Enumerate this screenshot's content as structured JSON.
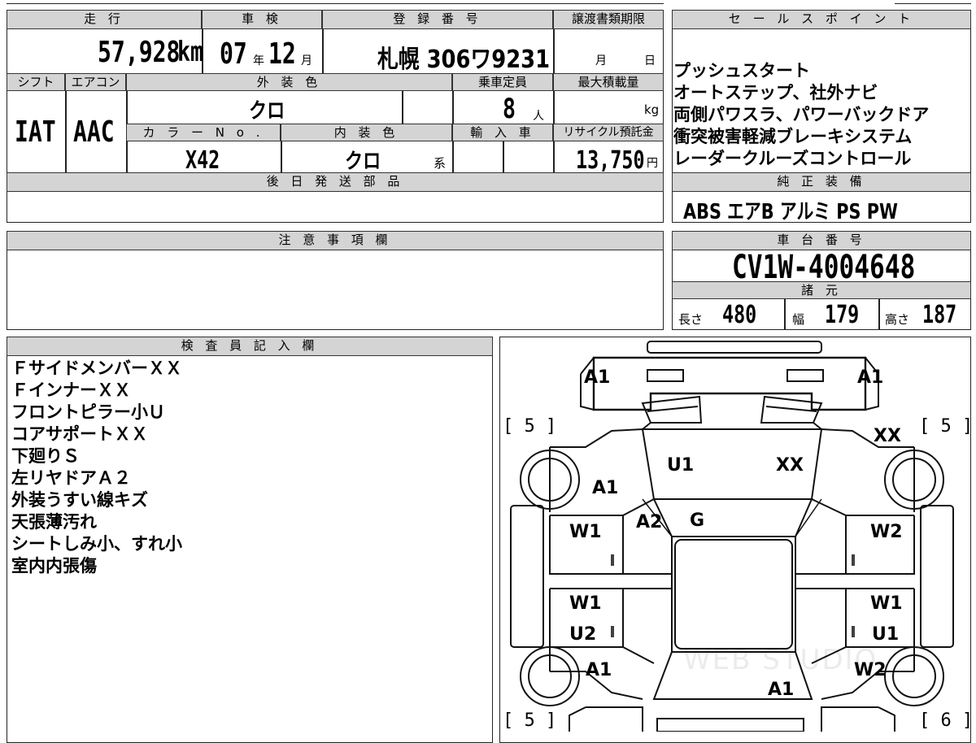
{
  "top_table": {
    "mileage": {
      "header": "走 行",
      "value": "57,928",
      "unit": "km"
    },
    "shaken": {
      "header": "車 検",
      "year": "07",
      "year_unit": "年",
      "month": "12",
      "month_unit": "月"
    },
    "registration": {
      "header": "登 録 番 号",
      "value": "札幌 306ワ9231"
    },
    "transfer_deadline": {
      "header": "譲渡書類期限",
      "month_unit": "月",
      "day_unit": "日"
    },
    "shift": {
      "header": "シフト",
      "value": "IAT"
    },
    "aircon": {
      "header": "エアコン",
      "value": "AAC"
    },
    "exterior_color": {
      "header": "外 装 色",
      "value": "クロ"
    },
    "capacity": {
      "header": "乗車定員",
      "value": "8",
      "unit": "人"
    },
    "max_load": {
      "header": "最大積載量",
      "unit": "kg"
    },
    "color_no": {
      "header": "カ ラ ー N o .",
      "value": "X42"
    },
    "interior_color": {
      "header": "内 装 色",
      "value": "クロ",
      "suffix": "系"
    },
    "import": {
      "header": "輸 入 車"
    },
    "recycle": {
      "header": "リサイクル預託金",
      "value": "13,750",
      "unit": "円"
    },
    "later_parts": {
      "header": "後 日 発 送 部 品"
    }
  },
  "sales_points": {
    "header": "セ ー ル ス ポ イ ン ト",
    "lines": [
      "プッシュスタート",
      "オートステップ、社外ナビ",
      "両側パワスラ、パワーバックドア",
      "衝突被害軽減ブレーキシステム",
      "レーダークルーズコントロール"
    ]
  },
  "genuine_equipment": {
    "header": "純 正 装 備",
    "value": "ABS エアB アルミ PS PW"
  },
  "notes": {
    "header": "注 意 事 項 欄"
  },
  "chassis": {
    "header": "車 台 番 号",
    "value": "CV1W-4004648"
  },
  "specs": {
    "header": "諸 元",
    "length_label": "長さ",
    "length": "480",
    "width_label": "幅",
    "width": "179",
    "height_label": "高さ",
    "height": "187"
  },
  "inspector": {
    "header": "検 査 員 記 入 欄",
    "lines": [
      "ＦサイドメンバーＸＸ",
      "ＦインナーＸＸ",
      "フロントピラー小Ｕ",
      "コアサポートＸＸ",
      "下廻りＳ",
      "左リヤドアＡ２",
      "外装うすい線キズ",
      "天張薄汚れ",
      "シートしみ小、すれ小",
      "室内内張傷"
    ]
  },
  "diagram": {
    "tire_marks": {
      "front_left": "[ 5 ]",
      "front_right": "[ 5 ]",
      "rear_left": "[ 5 ]",
      "rear_right": "[ 6 ]"
    },
    "labels": {
      "front_left": "A1",
      "front_right": "A1",
      "fender_right": "XX",
      "hood_left": "U1",
      "hood_right": "XX",
      "fender_left": "A1",
      "pillar_left": "A2",
      "windshield": "G",
      "front_door_left": "W1",
      "front_door_right": "W2",
      "rear_door_left_w": "W1",
      "rear_door_left_u": "U2",
      "rear_door_right_w": "W1",
      "rear_door_right_u": "U1",
      "rear_left": "A1",
      "rear_right": "W2",
      "rear_center": "A1"
    },
    "watermark": "WEB STUDIO"
  }
}
